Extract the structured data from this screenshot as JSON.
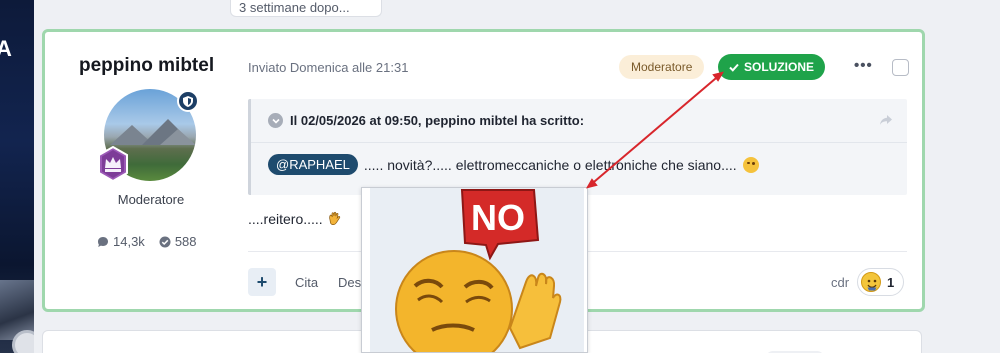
{
  "previous_post": {
    "tail_text": "3 settimane dopo..."
  },
  "post": {
    "author": {
      "name": "peppino mibtel",
      "role": "Moderatore",
      "stats": {
        "comments": "14,3k",
        "solutions": "588"
      },
      "icons": {
        "moderator_badge": "shield-icon",
        "rank_badge": "crown-icon"
      }
    },
    "meta": {
      "date": "Inviato Domenica alle 21:31",
      "role_pill": "Moderatore",
      "solution_label": "SOLUZIONE"
    },
    "quote": {
      "header": "Il 02/05/2026 at 09:50, peppino mibtel ha scritto:",
      "mention": "@RAPHAEL",
      "text": "..... novità?..... elettromeccaniche o elettroniche che siano...."
    },
    "reply_text": "....reitero.....",
    "actions": {
      "plus_label": "+",
      "cita_label": "Cita",
      "des_label": "Des"
    },
    "reactions": {
      "reactor": "cdr",
      "count": "1"
    }
  },
  "overlay": {
    "sticker_text": "NO"
  },
  "colors": {
    "solution_green": "#1fa34a",
    "post_border": "#9fd7ad",
    "mention_bg": "#1e4b6e",
    "role_pill_bg": "#fbeed8",
    "annotation_arrow": "#d8262c"
  }
}
